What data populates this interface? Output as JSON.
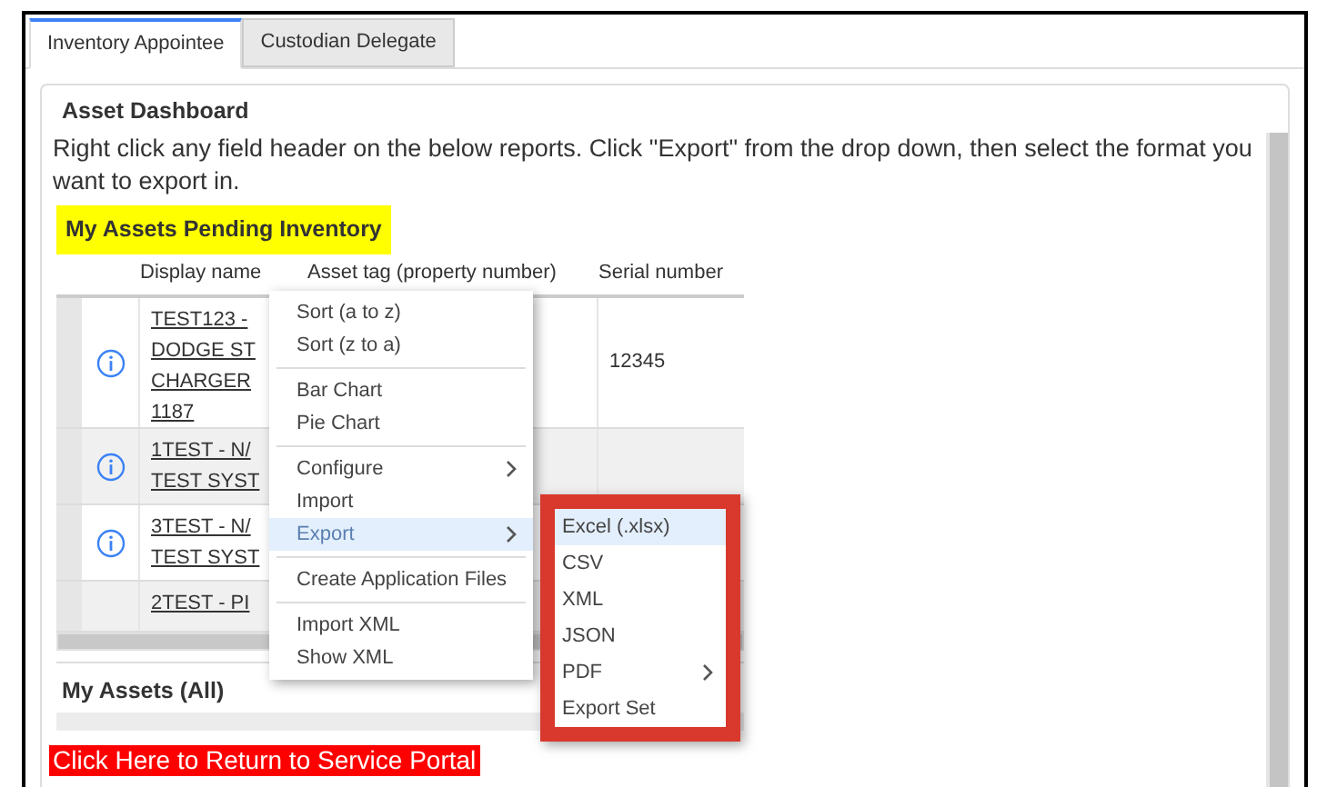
{
  "tabs": [
    {
      "label": "Inventory Appointee",
      "selected": true
    },
    {
      "label": "Custodian Delegate",
      "selected": false
    }
  ],
  "panel": {
    "title": "Asset Dashboard",
    "description": "Right click any field header on the below reports. Click \"Export\" from the drop down, then select the format you want to export in."
  },
  "pending_section": {
    "title": "My Assets Pending Inventory",
    "table": {
      "columns": [
        "Display name",
        "Asset tag (property number)",
        "Serial number"
      ],
      "rows": [
        {
          "display_name": [
            "TEST123 -",
            "DODGE ST",
            "CHARGER",
            "1187"
          ],
          "serial_number": "12345"
        },
        {
          "display_name": [
            "1TEST - N/",
            "TEST SYST"
          ],
          "serial_number": ""
        },
        {
          "display_name": [
            "3TEST - N/",
            "TEST SYST"
          ],
          "serial_number": ""
        },
        {
          "display_name": [
            "2TEST - PI"
          ],
          "serial_number": ""
        }
      ]
    }
  },
  "all_section": {
    "title": "My Assets (All)"
  },
  "portal_link": "Click Here to Return to Service Portal",
  "context_menu": [
    {
      "kind": "item",
      "label": "Sort (a to z)",
      "selected": false,
      "submenu": false
    },
    {
      "kind": "item",
      "label": "Sort (z to a)",
      "selected": false,
      "submenu": false
    },
    {
      "kind": "separator"
    },
    {
      "kind": "item",
      "label": "Bar Chart",
      "selected": false,
      "submenu": false
    },
    {
      "kind": "item",
      "label": "Pie Chart",
      "selected": false,
      "submenu": false
    },
    {
      "kind": "separator"
    },
    {
      "kind": "item",
      "label": "Configure",
      "selected": false,
      "submenu": true
    },
    {
      "kind": "item",
      "label": "Import",
      "selected": false,
      "submenu": false
    },
    {
      "kind": "item",
      "label": "Export",
      "selected": true,
      "submenu": true
    },
    {
      "kind": "separator"
    },
    {
      "kind": "item",
      "label": "Create Application Files",
      "selected": false,
      "submenu": false
    },
    {
      "kind": "separator"
    },
    {
      "kind": "item",
      "label": "Import XML",
      "selected": false,
      "submenu": false
    },
    {
      "kind": "item",
      "label": "Show XML",
      "selected": false,
      "submenu": false
    }
  ],
  "export_submenu": [
    {
      "label": "Excel (.xlsx)",
      "selected": true,
      "submenu": false
    },
    {
      "label": "CSV",
      "selected": false,
      "submenu": false
    },
    {
      "label": "XML",
      "selected": false,
      "submenu": false
    },
    {
      "label": "JSON",
      "selected": false,
      "submenu": false
    },
    {
      "label": "PDF",
      "selected": false,
      "submenu": true
    },
    {
      "label": "Export Set",
      "selected": false,
      "submenu": false
    }
  ]
}
